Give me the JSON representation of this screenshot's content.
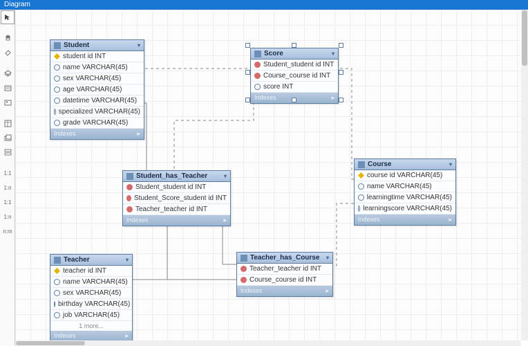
{
  "title": "Diagram",
  "entities": {
    "student": {
      "name": "Student",
      "columns": [
        {
          "icon": "key",
          "text": "student id INT"
        },
        {
          "icon": "col",
          "text": "name VARCHAR(45)"
        },
        {
          "icon": "col",
          "text": "sex VARCHAR(45)"
        },
        {
          "icon": "col",
          "text": "age VARCHAR(45)"
        },
        {
          "icon": "col",
          "text": "datetime VARCHAR(45)"
        },
        {
          "icon": "col",
          "text": "specialized VARCHAR(45)"
        },
        {
          "icon": "col",
          "text": "grade VARCHAR(45)"
        }
      ],
      "indexes": "Indexes"
    },
    "score": {
      "name": "Score",
      "columns": [
        {
          "icon": "fk",
          "text": "Student_student id INT"
        },
        {
          "icon": "fk",
          "text": "Course_course id INT"
        },
        {
          "icon": "col",
          "text": "score INT"
        }
      ],
      "indexes": "Indexes"
    },
    "sht": {
      "name": "Student_has_Teacher",
      "columns": [
        {
          "icon": "fk",
          "text": "Student_student id INT"
        },
        {
          "icon": "fk",
          "text": "Student_Score_student id INT"
        },
        {
          "icon": "fk",
          "text": "Teacher_teacher id INT"
        }
      ],
      "indexes": "Indexes"
    },
    "course": {
      "name": "Course",
      "columns": [
        {
          "icon": "key",
          "text": "course id VARCHAR(45)"
        },
        {
          "icon": "col",
          "text": "name VARCHAR(45)"
        },
        {
          "icon": "col",
          "text": "learningtime VARCHAR(45)"
        },
        {
          "icon": "col",
          "text": "learningscore VARCHAR(45)"
        }
      ],
      "indexes": "Indexes"
    },
    "teacher": {
      "name": "Teacher",
      "columns": [
        {
          "icon": "key",
          "text": "teacher id INT"
        },
        {
          "icon": "col",
          "text": "name VARCHAR(45)"
        },
        {
          "icon": "col",
          "text": "sex VARCHAR(45)"
        },
        {
          "icon": "col",
          "text": "birthday VARCHAR(45)"
        },
        {
          "icon": "col",
          "text": "job VARCHAR(45)"
        }
      ],
      "more": "1 more...",
      "indexes": "Indexes"
    },
    "thc": {
      "name": "Teacher_has_Course",
      "columns": [
        {
          "icon": "fk",
          "text": "Teacher_teacher id INT"
        },
        {
          "icon": "fk",
          "text": "Course_course id INT"
        }
      ],
      "indexes": "Indexes"
    }
  },
  "toolbar_labels": {
    "t11": "1:1",
    "t1n": "1:n",
    "t11b": "1:1",
    "t1nb": "1:n",
    "tnm": "n:m"
  }
}
